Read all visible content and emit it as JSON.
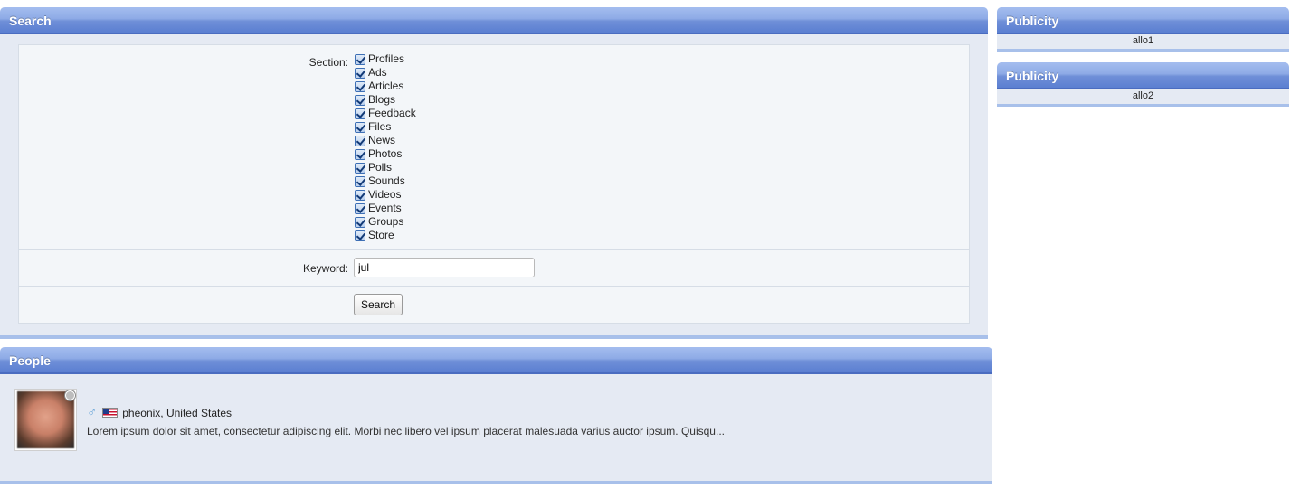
{
  "search": {
    "title": "Search",
    "section_label": "Section:",
    "sections": [
      "Profiles",
      "Ads",
      "Articles",
      "Blogs",
      "Feedback",
      "Files",
      "News",
      "Photos",
      "Polls",
      "Sounds",
      "Videos",
      "Events",
      "Groups",
      "Store"
    ],
    "keyword_label": "Keyword:",
    "keyword_value": "jul",
    "button_label": "Search"
  },
  "people": {
    "title": "People",
    "person": {
      "gender_icon": "male-icon",
      "flag_icon": "us-flag-icon",
      "name_location": "pheonix, United States",
      "description": "Lorem ipsum dolor sit amet, consectetur adipiscing elit. Morbi nec libero vel ipsum placerat malesuada varius auctor ipsum. Quisqu..."
    }
  },
  "publicity": [
    {
      "title": "Publicity",
      "content": "allo1"
    },
    {
      "title": "Publicity",
      "content": "allo2"
    }
  ],
  "colors": {
    "header_blue": "#5b7fd1",
    "panel_bg": "#e5eaf3",
    "form_bg": "#f3f6f9"
  }
}
